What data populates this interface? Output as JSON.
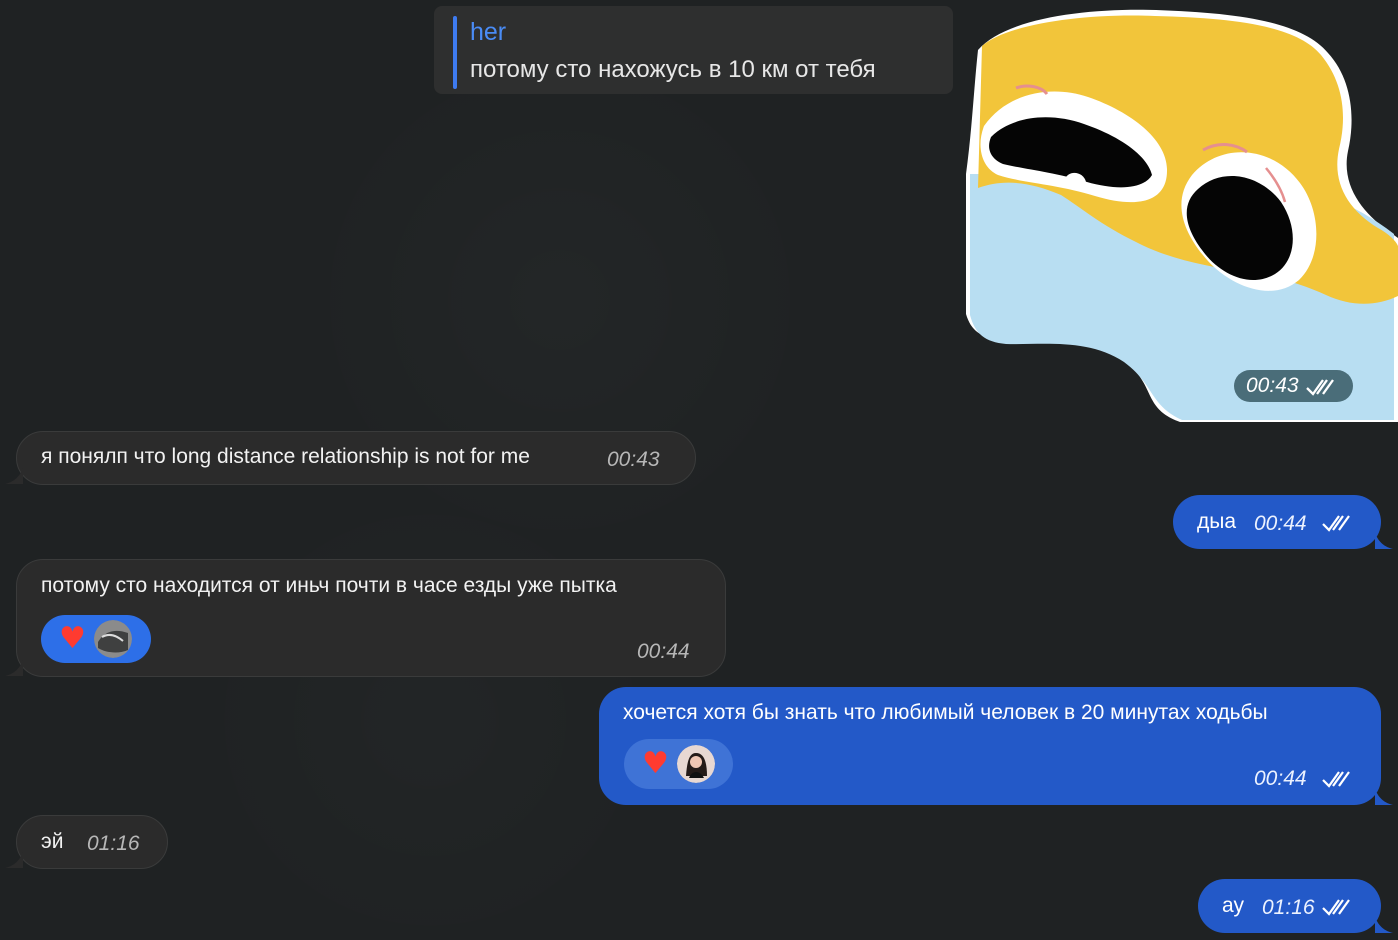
{
  "reply": {
    "name": "her",
    "text": "потому сто нахожусь в 10 км от тебя"
  },
  "sticker": {
    "time": "00:43",
    "status_icon": "double-check-icon"
  },
  "messages": [
    {
      "direction": "incoming",
      "text": "я понялп что long distance relationship is not for me",
      "time": "00:43"
    },
    {
      "direction": "outgoing",
      "text": "дыа",
      "time": "00:44",
      "status_icon": "double-check-icon"
    },
    {
      "direction": "incoming",
      "text": "потому сто находится от иньч почти в часе езды уже пытка",
      "time": "00:44",
      "reaction": "heart-emoji",
      "reactor": "avatar"
    },
    {
      "direction": "outgoing",
      "text": "хочется хотя бы знать что любимый человек в 20 минутах ходьбы",
      "time": "00:44",
      "reaction": "heart-emoji",
      "reactor": "avatar",
      "status_icon": "double-check-icon"
    },
    {
      "direction": "incoming",
      "text": "эй",
      "time": "01:16"
    },
    {
      "direction": "outgoing",
      "text": "ау",
      "time": "01:16",
      "status_icon": "double-check-icon"
    }
  ],
  "colors": {
    "background": "#1f2223",
    "incoming_bubble": "#2b2b2b",
    "outgoing_bubble": "#2359c8",
    "reply_accent": "#3e7bf0",
    "reaction_bubble_incoming": "#2d6fe8",
    "reaction_bubble_outgoing": "#3f73d6"
  }
}
